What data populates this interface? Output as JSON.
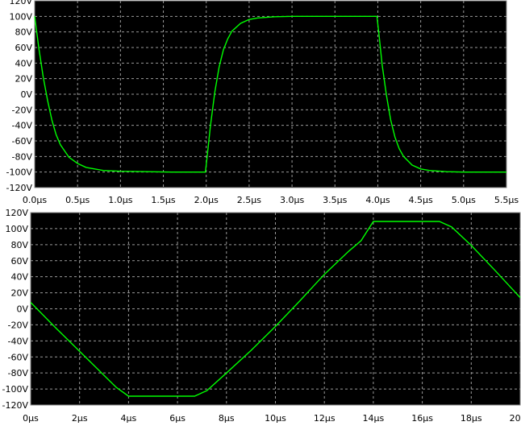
{
  "colors": {
    "background": "#000000",
    "trace": "#00ff00",
    "grid": "#9a9a9a",
    "frame": "#8c8c8c",
    "text": "#000000"
  },
  "chart_data": [
    {
      "type": "line",
      "title": "",
      "xlabel": "",
      "ylabel": "",
      "xlim": [
        0,
        5.5
      ],
      "ylim": [
        -120,
        120
      ],
      "x_ticks": [
        0,
        0.5,
        1.0,
        1.5,
        2.0,
        2.5,
        3.0,
        3.5,
        4.0,
        4.5,
        5.0,
        5.5
      ],
      "x_tick_labels": [
        "0.0µs",
        "0.5µs",
        "1.0µs",
        "1.5µs",
        "2.0µs",
        "2.5µs",
        "3.0µs",
        "3.5µs",
        "4.0µs",
        "4.5µs",
        "5.0µs",
        "5.5µs"
      ],
      "y_ticks": [
        120,
        100,
        80,
        60,
        40,
        20,
        0,
        -20,
        -40,
        -60,
        -80,
        -100,
        -120
      ],
      "y_tick_labels": [
        "120V",
        "100V",
        "80V",
        "60V",
        "40V",
        "20V",
        "0V",
        "-20V",
        "-40V",
        "-60V",
        "-80V",
        "-100V",
        "-120V"
      ],
      "grid": true,
      "series": [
        {
          "x": [
            0,
            0.05,
            0.1,
            0.15,
            0.2,
            0.25,
            0.3,
            0.4,
            0.5,
            0.6,
            0.8,
            1.0,
            1.3,
            1.6,
            1.99,
            2.02,
            2.05,
            2.1,
            2.15,
            2.2,
            2.25,
            2.3,
            2.4,
            2.5,
            2.6,
            2.8,
            3.0,
            3.5,
            3.99,
            4.02,
            4.05,
            4.1,
            4.15,
            4.2,
            4.25,
            4.3,
            4.4,
            4.5,
            4.6,
            4.8,
            5.0,
            5.5
          ],
          "y": [
            100,
            58,
            22,
            -8,
            -33,
            -52,
            -65,
            -81,
            -89,
            -94,
            -98,
            -99,
            -99.5,
            -100,
            -100,
            -70,
            -40,
            3,
            35,
            57,
            71,
            81,
            91,
            96,
            98,
            99.5,
            100,
            100,
            100,
            70,
            38,
            -1,
            -33,
            -55,
            -70,
            -80,
            -91,
            -96,
            -98,
            -99.5,
            -100,
            -100
          ]
        }
      ]
    },
    {
      "type": "line",
      "title": "",
      "xlabel": "",
      "ylabel": "",
      "xlim": [
        0,
        20
      ],
      "ylim": [
        -120,
        120
      ],
      "x_ticks": [
        0,
        2,
        4,
        6,
        8,
        10,
        12,
        14,
        16,
        18,
        20
      ],
      "x_tick_labels": [
        "0µs",
        "2µs",
        "4µs",
        "6µs",
        "8µs",
        "10µs",
        "12µs",
        "14µs",
        "16µs",
        "18µs",
        "20µs"
      ],
      "y_ticks": [
        120,
        100,
        80,
        60,
        40,
        20,
        0,
        -20,
        -40,
        -60,
        -80,
        -100,
        -120
      ],
      "y_tick_labels": [
        "120V",
        "100V",
        "80V",
        "60V",
        "40V",
        "20V",
        "0V",
        "-20V",
        "-40V",
        "-60V",
        "-80V",
        "-100V",
        "-120V"
      ],
      "grid": true,
      "series": [
        {
          "x": [
            0,
            1,
            2,
            3,
            3.5,
            4,
            5,
            6,
            6.7,
            7.2,
            8,
            9,
            10,
            11,
            12,
            13,
            13.5,
            14,
            15,
            16,
            16.7,
            17.2,
            18,
            19,
            20
          ],
          "y": [
            8,
            -23,
            -53,
            -83,
            -98,
            -109,
            -109,
            -109,
            -109,
            -102,
            -80,
            -52,
            -22,
            10,
            43,
            72,
            85,
            109,
            109,
            109,
            109,
            102,
            79,
            47,
            14
          ]
        }
      ]
    }
  ]
}
